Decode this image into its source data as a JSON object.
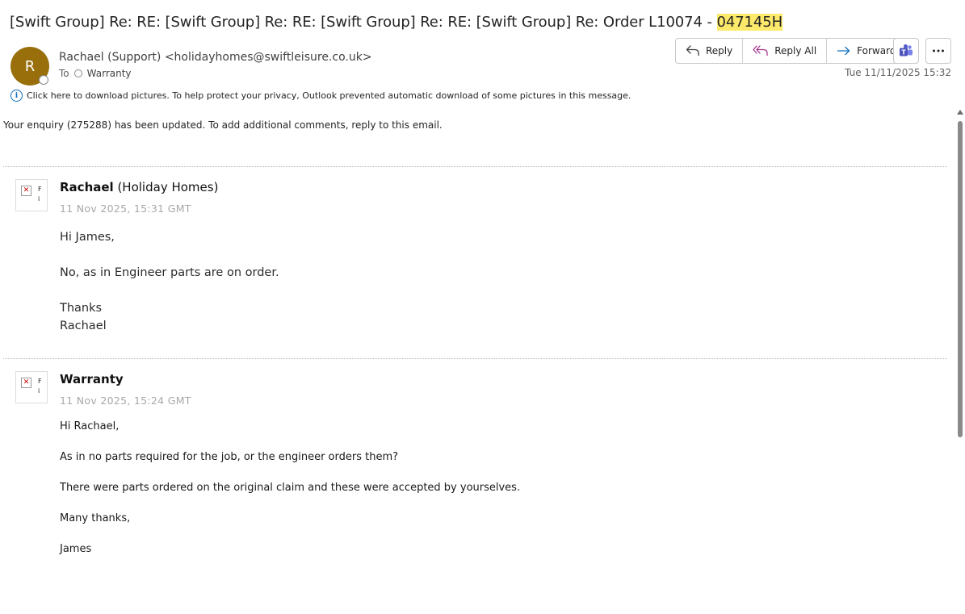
{
  "email": {
    "subject_prefix": "[Swift Group] Re: RE: [Swift Group] Re: RE: [Swift Group] Re: RE: [Swift Group] Re: Order L10074 - ",
    "subject_highlight": "047145H",
    "avatar_initial": "R",
    "from": "Rachael (Support) <holidayhomes@swiftleisure.co.uk>",
    "to_label": "To",
    "to_recipient": "Warranty",
    "date": "Tue 11/11/2025 15:32",
    "info_bar": "Click here to download pictures. To help protect your privacy, Outlook prevented automatic download of some pictures in this message."
  },
  "actions": {
    "reply": "Reply",
    "reply_all": "Reply All",
    "forward": "Forward",
    "teams_icon": "teams-icon",
    "more_icon": "more-icon"
  },
  "body": {
    "intro": "Your enquiry (275288) has been updated. To add additional comments, reply to this email.",
    "messages": [
      {
        "author_name": "Rachael",
        "author_org": " (Holiday Homes)",
        "timestamp": "11 Nov 2025, 15:31 GMT",
        "thumb_text_1": "F",
        "thumb_text_2": "i",
        "lines": [
          "Hi James,",
          "No, as in Engineer parts are on order.",
          "Thanks",
          "Rachael"
        ]
      },
      {
        "author_name": "Warranty",
        "author_org": "",
        "timestamp": "11 Nov 2025, 15:24 GMT",
        "thumb_text_1": "F",
        "thumb_text_2": "i",
        "lines": [
          "Hi Rachael,",
          "As in no parts required for the job, or the engineer orders them?",
          "There were parts ordered on the original claim and these were accepted by yourselves.",
          "Many thanks,",
          "James"
        ]
      }
    ]
  },
  "colors": {
    "avatar": "#986f0b",
    "highlight": "#fde96a",
    "accent": "#0f6cbd",
    "reply_all_icon": "#a4378e"
  }
}
